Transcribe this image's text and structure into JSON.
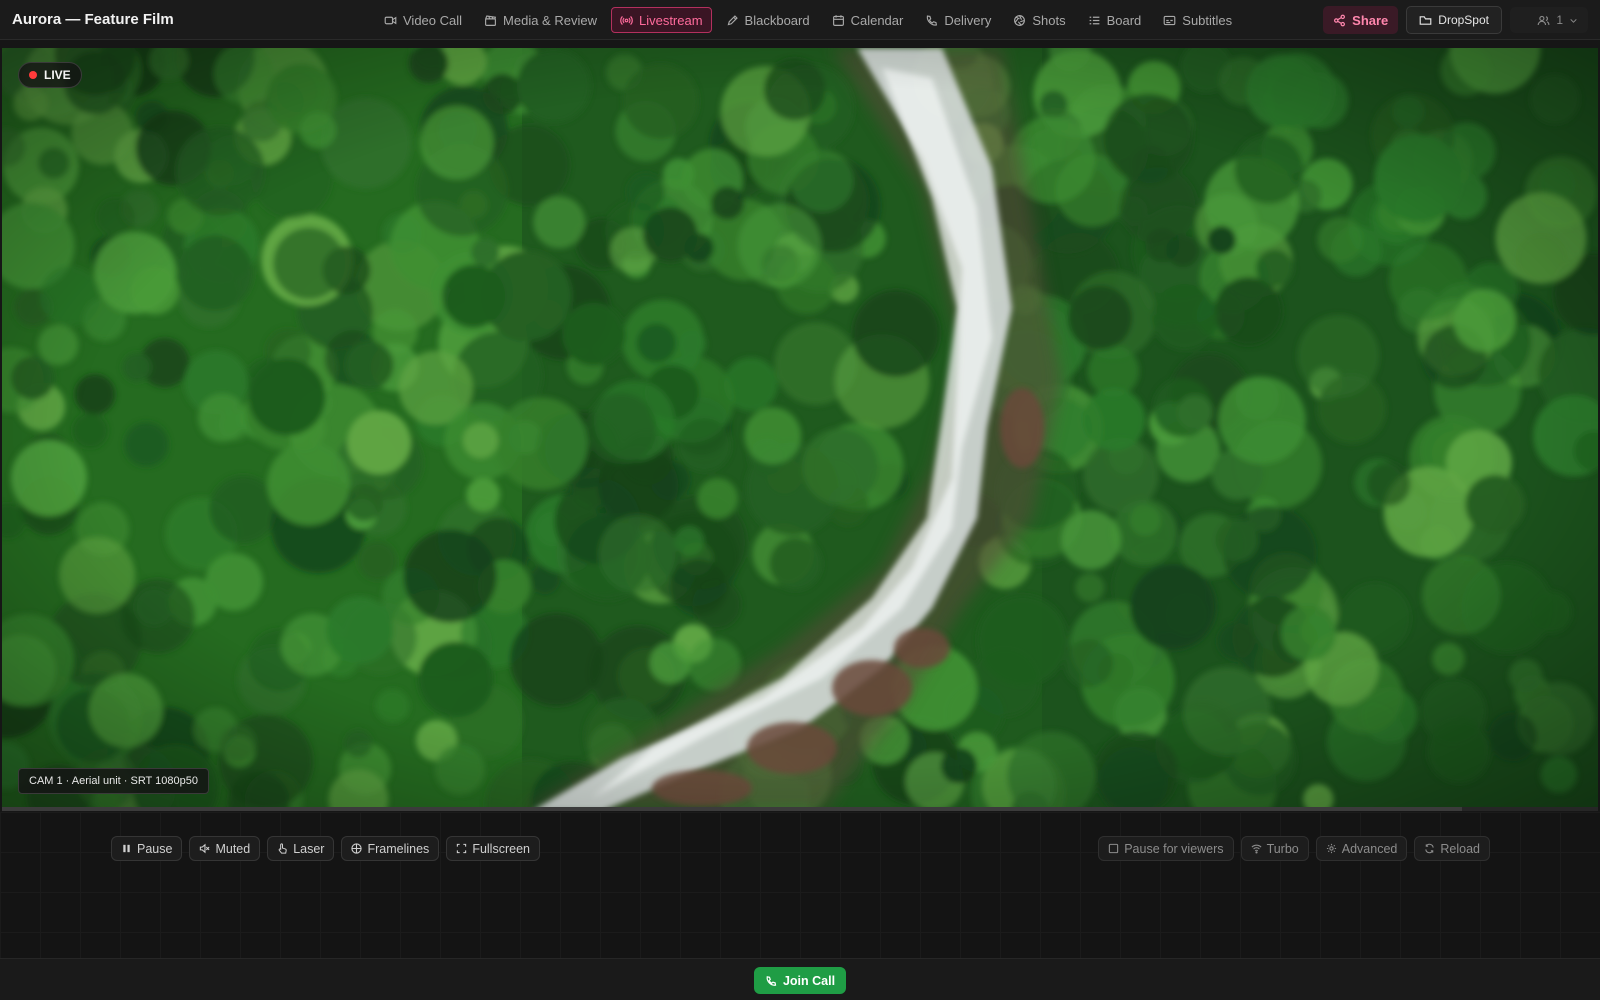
{
  "app": {
    "title": "Aurora — Feature Film"
  },
  "nav": {
    "tabs": [
      {
        "label": "Video Call",
        "icon": "video-camera-icon"
      },
      {
        "label": "Media & Review",
        "icon": "clapperboard-icon"
      },
      {
        "label": "Livestream",
        "icon": "broadcast-icon",
        "active": true
      },
      {
        "label": "Blackboard",
        "icon": "pen-icon"
      },
      {
        "label": "Calendar",
        "icon": "calendar-icon"
      },
      {
        "label": "Delivery",
        "icon": "phone-icon"
      },
      {
        "label": "Shots",
        "icon": "aperture-icon"
      },
      {
        "label": "Board",
        "icon": "list-icon"
      },
      {
        "label": "Subtitles",
        "icon": "captions-icon"
      }
    ]
  },
  "header_actions": {
    "share_label": "Share",
    "dropspot_label": "DropSpot",
    "users_count": "1"
  },
  "stage": {
    "live_label": "LIVE",
    "camera_caption": "CAM 1 · Aerial unit · SRT 1080p50",
    "progress_fraction": 0.915
  },
  "controls": {
    "left": [
      {
        "label": "Pause",
        "icon": "pause-icon"
      },
      {
        "label": "Muted",
        "icon": "speaker-muted-icon"
      },
      {
        "label": "Laser",
        "icon": "hand-pointer-icon"
      },
      {
        "label": "Framelines",
        "icon": "framelines-icon"
      },
      {
        "label": "Fullscreen",
        "icon": "fullscreen-icon"
      }
    ],
    "right": [
      {
        "label": "Pause for viewers",
        "icon": "checkbox-icon"
      },
      {
        "label": "Turbo",
        "icon": "wifi-icon"
      },
      {
        "label": "Advanced",
        "icon": "gear-icon"
      },
      {
        "label": "Reload",
        "icon": "refresh-icon"
      }
    ]
  },
  "bottom": {
    "join_label": "Join Call"
  },
  "colors": {
    "accent": "#ff6b9c",
    "live": "#ff3b3b",
    "join": "#1f9d45"
  }
}
